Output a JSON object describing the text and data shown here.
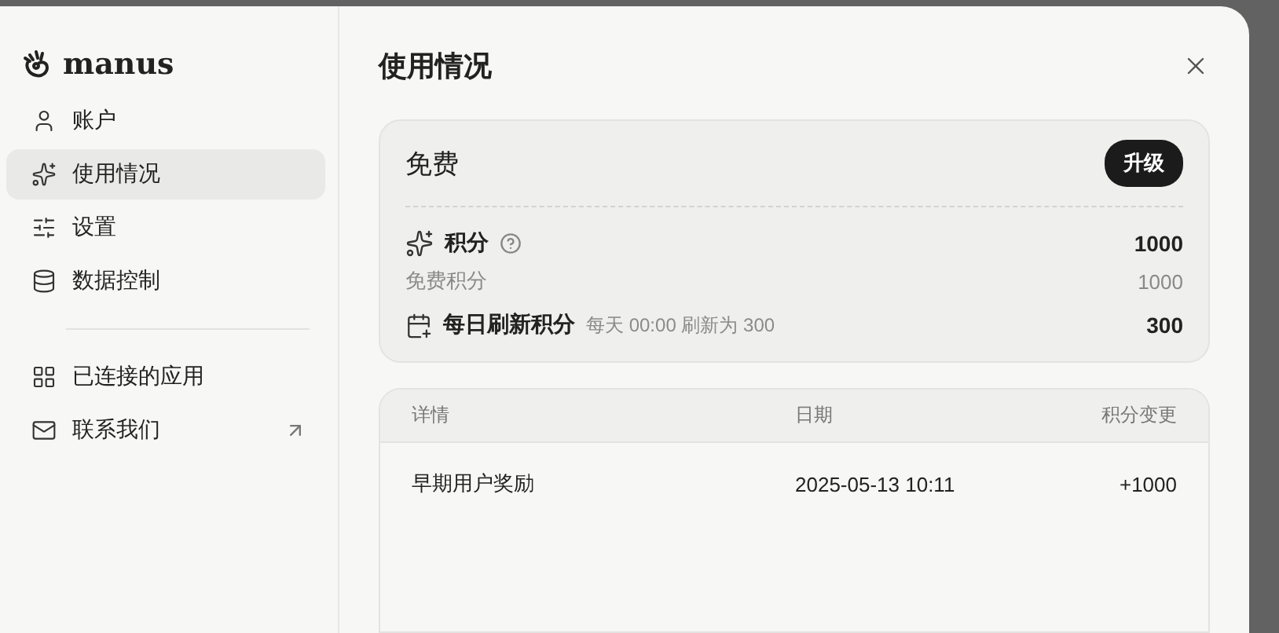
{
  "sidebar": {
    "brand": "manus",
    "items": [
      {
        "kind": "account",
        "label": "账户",
        "selected": false
      },
      {
        "kind": "usage",
        "label": "使用情况",
        "selected": true
      },
      {
        "kind": "settings",
        "label": "设置",
        "selected": false
      },
      {
        "kind": "data",
        "label": "数据控制",
        "selected": false
      },
      {
        "kind": "divider"
      },
      {
        "kind": "apps",
        "label": "已连接的应用",
        "selected": false
      },
      {
        "kind": "contact",
        "label": "联系我们",
        "selected": false,
        "external": true
      }
    ]
  },
  "title": "使用情况",
  "plan": {
    "name": "免费",
    "upgrade": "升级",
    "credits": {
      "label": "积分",
      "value": "1000"
    },
    "free_credits": {
      "label": "免费积分",
      "value": "1000"
    },
    "daily": {
      "label": "每日刷新积分",
      "note": "每天 00:00 刷新为 300",
      "value": "300"
    }
  },
  "table": {
    "columns": [
      "详情",
      "日期",
      "积分变更"
    ],
    "rows": [
      [
        "早期用户奖励",
        "2025-05-13 10:11",
        "+1000"
      ]
    ]
  }
}
